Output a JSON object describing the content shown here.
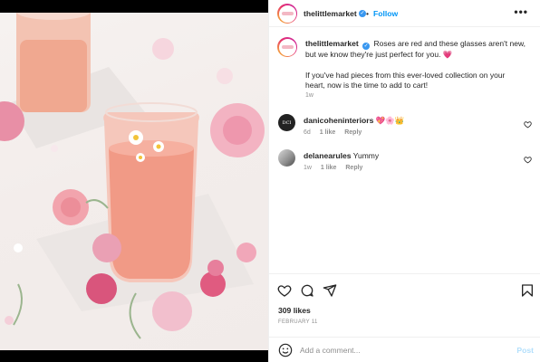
{
  "post": {
    "author": "thelittlemarket",
    "follow_label": "Follow",
    "dot": "•",
    "more_label": "•••",
    "caption_line1": "Roses are red and these glasses aren't new,",
    "caption_line2": "but we know they're just perfect for you.",
    "caption_emoji": "💗",
    "caption_line3": "If you've had pieces from this ever-loved collection on your",
    "caption_line4": "heart, now is the time to add to cart!",
    "caption_time": "1w",
    "likes": "309 likes",
    "date": "FEBRUARY 11"
  },
  "comments": [
    {
      "username": "danicoheninteriors",
      "text": "💖🌸👑",
      "avatar_text": "DCI",
      "time": "6d",
      "likes": "1 like",
      "reply": "Reply"
    },
    {
      "username": "delanearules",
      "text": "Yummy",
      "time": "1w",
      "likes": "1 like",
      "reply": "Reply"
    }
  ],
  "add_comment": {
    "placeholder": "Add a comment...",
    "post_label": "Post"
  },
  "icons": {
    "like": "heart-icon",
    "comment": "comment-icon",
    "share": "share-icon",
    "save": "bookmark-icon",
    "emoji": "emoji-icon",
    "more": "more-icon",
    "verified": "verified-badge-icon"
  },
  "colors": {
    "accent": "#0095f6",
    "verified": "#3897f0",
    "muted": "#8e8e8e",
    "post_disabled": "#b2dffc"
  }
}
